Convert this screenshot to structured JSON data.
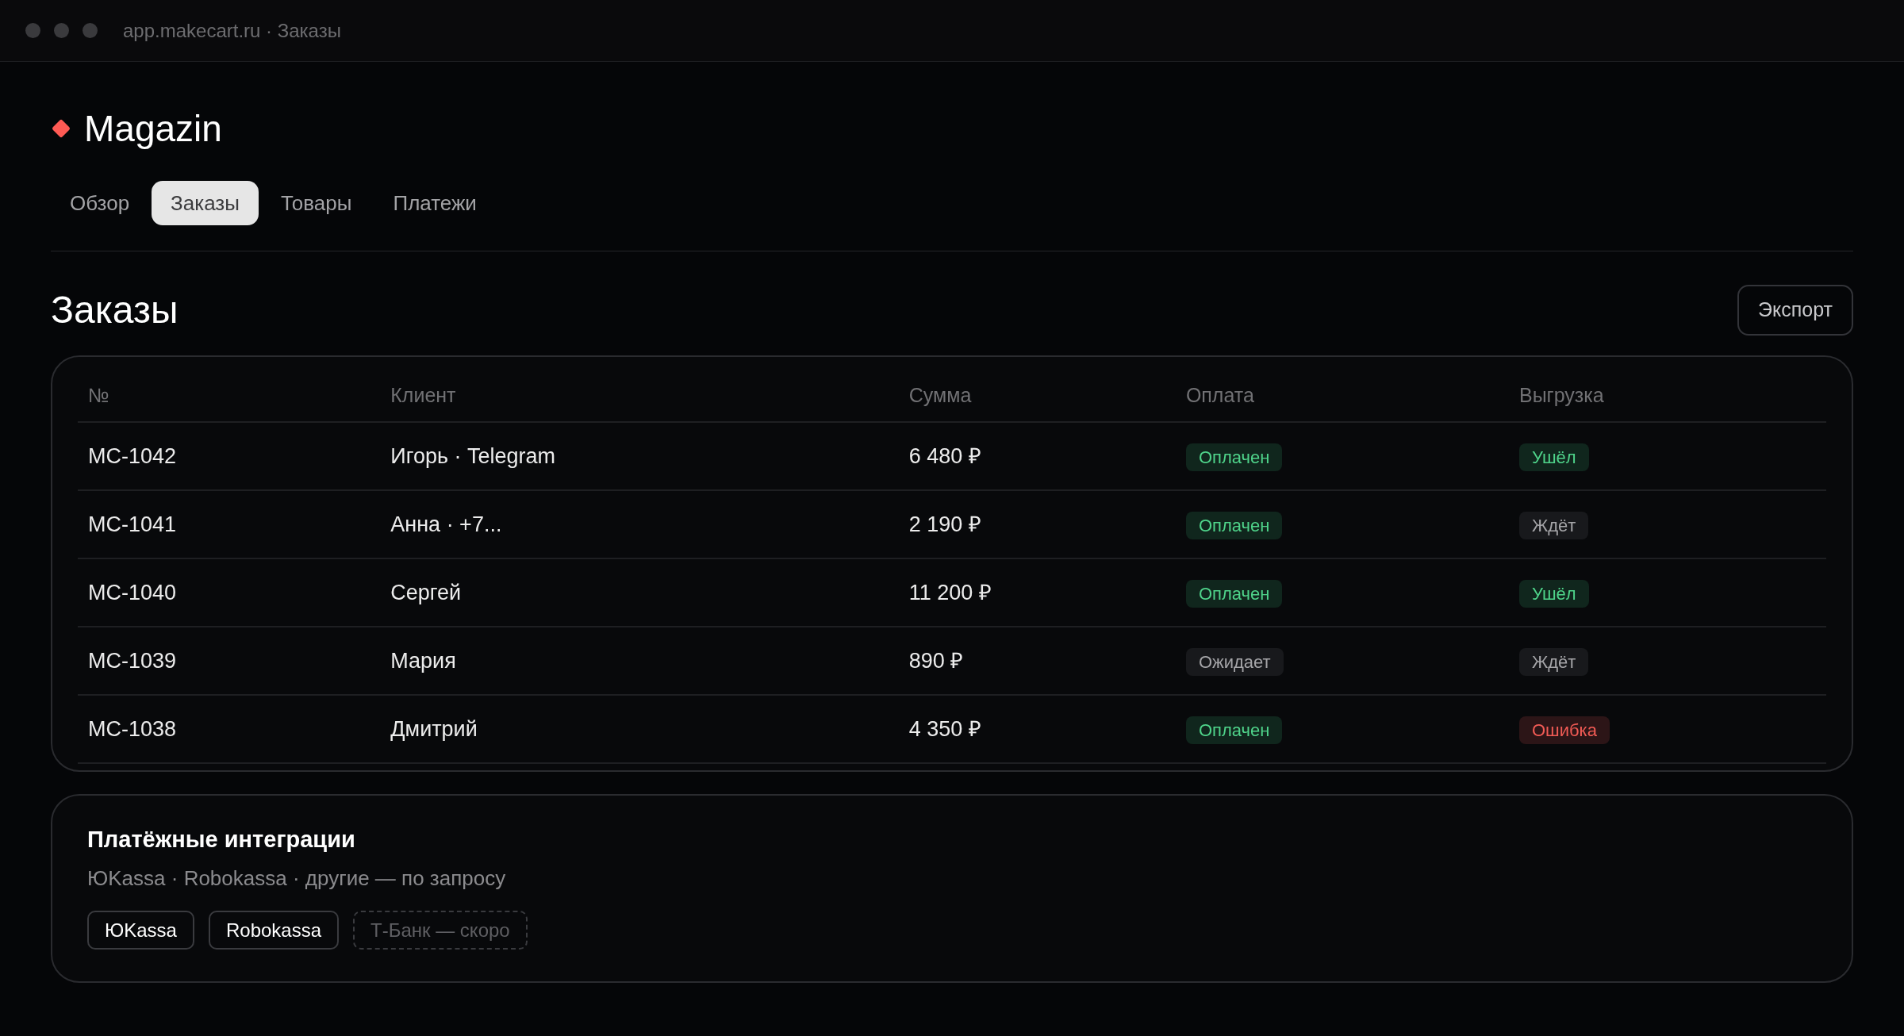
{
  "window": {
    "title": "app.makecart.ru · Заказы"
  },
  "brand": {
    "name": "Magazin"
  },
  "tabs": [
    {
      "label": "Обзор",
      "selected": false
    },
    {
      "label": "Заказы",
      "selected": true
    },
    {
      "label": "Товары",
      "selected": false
    },
    {
      "label": "Платежи",
      "selected": false
    }
  ],
  "page": {
    "title": "Заказы",
    "export_button": "Экспорт"
  },
  "orders_table": {
    "columns": [
      "№",
      "Клиент",
      "Сумма",
      "Оплата",
      "Выгрузка"
    ],
    "rows": [
      {
        "number": "MC-1042",
        "client": "Игорь · Telegram",
        "sum": "6 480 ₽",
        "payment": {
          "label": "Оплачен",
          "kind": "success"
        },
        "export": {
          "label": "Ушёл",
          "kind": "success"
        }
      },
      {
        "number": "MC-1041",
        "client": "Анна · +7...",
        "sum": "2 190 ₽",
        "payment": {
          "label": "Оплачен",
          "kind": "success"
        },
        "export": {
          "label": "Ждёт",
          "kind": "neutral"
        }
      },
      {
        "number": "MC-1040",
        "client": "Сергей",
        "sum": "11 200 ₽",
        "payment": {
          "label": "Оплачен",
          "kind": "success"
        },
        "export": {
          "label": "Ушёл",
          "kind": "success"
        }
      },
      {
        "number": "MC-1039",
        "client": "Мария",
        "sum": "890 ₽",
        "payment": {
          "label": "Ожидает",
          "kind": "neutral"
        },
        "export": {
          "label": "Ждёт",
          "kind": "neutral"
        }
      },
      {
        "number": "MC-1038",
        "client": "Дмитрий",
        "sum": "4 350 ₽",
        "payment": {
          "label": "Оплачен",
          "kind": "success"
        },
        "export": {
          "label": "Ошибка",
          "kind": "danger"
        }
      }
    ]
  },
  "integrations": {
    "title": "Платёжные интеграции",
    "subtitle": "ЮKassa · Robokassa · другие — по запросу",
    "chips": [
      {
        "label": "ЮKassa",
        "disabled": false
      },
      {
        "label": "Robokassa",
        "disabled": false
      },
      {
        "label": "Т-Банк — скоро",
        "disabled": true
      }
    ]
  }
}
